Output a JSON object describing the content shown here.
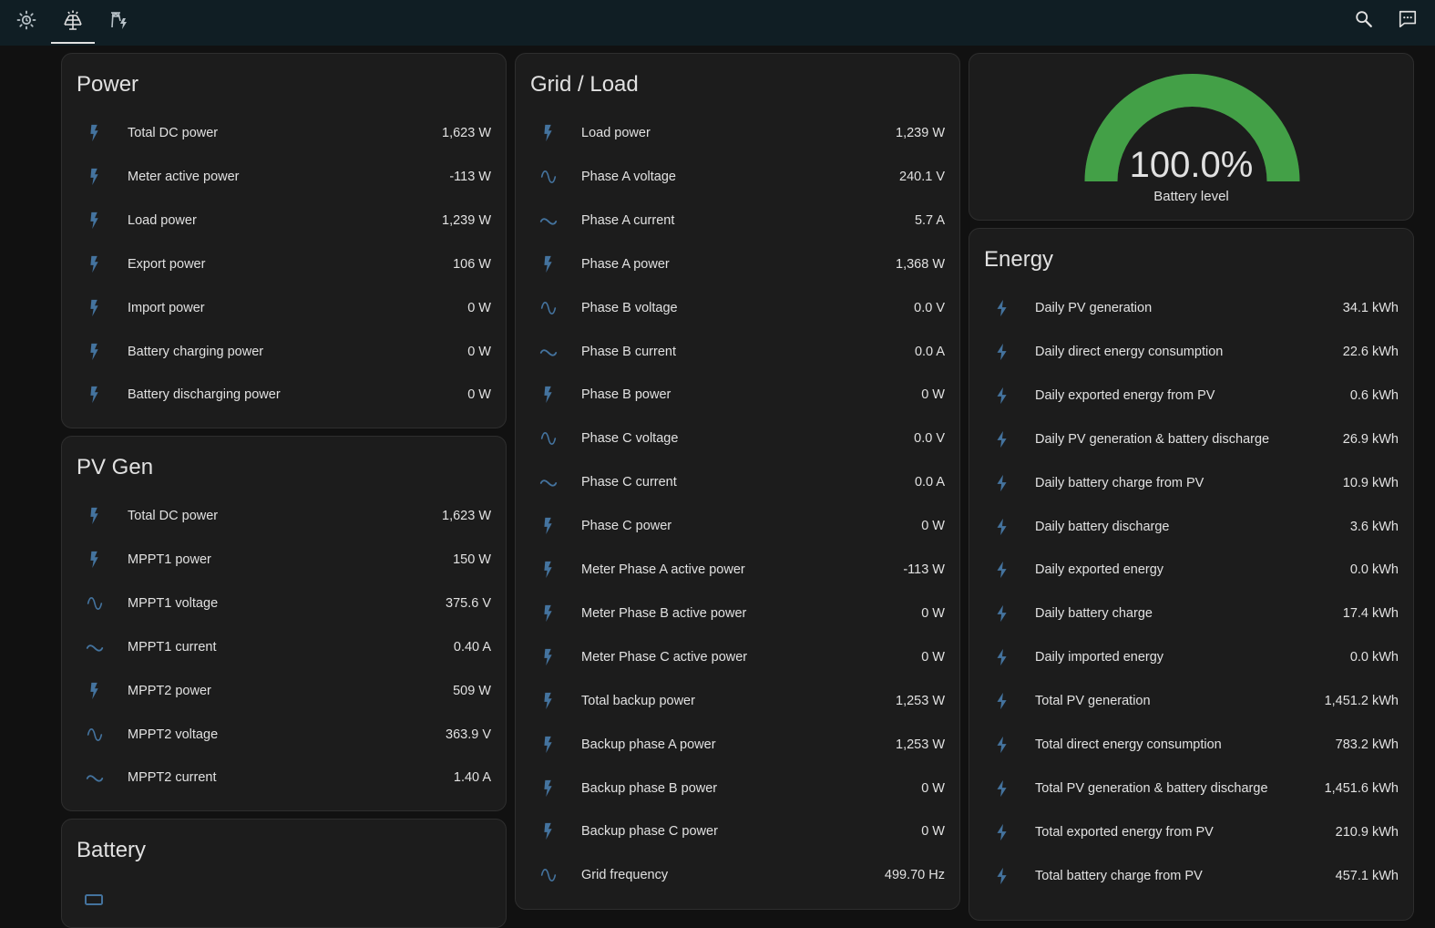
{
  "colors": {
    "header_bg": "#101e24",
    "card_bg": "#1c1c1c",
    "icon_blue": "#44739e",
    "gauge_green": "#43a047",
    "text": "#e1e1e1"
  },
  "header": {
    "tabs": [
      {
        "icon": "sun-clock-icon"
      },
      {
        "icon": "solar-panel-icon",
        "active": true
      },
      {
        "icon": "transmission-tower-icon"
      }
    ],
    "actions": [
      {
        "icon": "search-icon"
      },
      {
        "icon": "assist-chat-icon"
      }
    ]
  },
  "power": {
    "title": "Power",
    "rows": [
      {
        "icon": "flash-icon",
        "label": "Total DC power",
        "value": "1,623 W"
      },
      {
        "icon": "flash-icon",
        "label": "Meter active power",
        "value": "-113 W"
      },
      {
        "icon": "flash-icon",
        "label": "Load power",
        "value": "1,239 W"
      },
      {
        "icon": "flash-icon",
        "label": "Export power",
        "value": "106 W"
      },
      {
        "icon": "flash-icon",
        "label": "Import power",
        "value": "0 W"
      },
      {
        "icon": "flash-icon",
        "label": "Battery charging power",
        "value": "0 W"
      },
      {
        "icon": "flash-icon",
        "label": "Battery discharging power",
        "value": "0 W"
      }
    ]
  },
  "pvgen": {
    "title": "PV Gen",
    "rows": [
      {
        "icon": "flash-icon",
        "label": "Total DC power",
        "value": "1,623 W"
      },
      {
        "icon": "flash-icon",
        "label": "MPPT1 power",
        "value": "150 W"
      },
      {
        "icon": "sine-wave-icon",
        "label": "MPPT1 voltage",
        "value": "375.6 V"
      },
      {
        "icon": "current-ac-icon",
        "label": "MPPT1 current",
        "value": "0.40 A"
      },
      {
        "icon": "flash-icon",
        "label": "MPPT2 power",
        "value": "509 W"
      },
      {
        "icon": "sine-wave-icon",
        "label": "MPPT2 voltage",
        "value": "363.9 V"
      },
      {
        "icon": "current-ac-icon",
        "label": "MPPT2 current",
        "value": "1.40 A"
      }
    ]
  },
  "battery": {
    "title": "Battery"
  },
  "gridload": {
    "title": "Grid / Load",
    "rows": [
      {
        "icon": "flash-icon",
        "label": "Load power",
        "value": "1,239 W"
      },
      {
        "icon": "sine-wave-icon",
        "label": "Phase A voltage",
        "value": "240.1 V"
      },
      {
        "icon": "current-ac-icon",
        "label": "Phase A current",
        "value": "5.7 A"
      },
      {
        "icon": "flash-icon",
        "label": "Phase A power",
        "value": "1,368 W"
      },
      {
        "icon": "sine-wave-icon",
        "label": "Phase B voltage",
        "value": "0.0 V"
      },
      {
        "icon": "current-ac-icon",
        "label": "Phase B current",
        "value": "0.0 A"
      },
      {
        "icon": "flash-icon",
        "label": "Phase B power",
        "value": "0 W"
      },
      {
        "icon": "sine-wave-icon",
        "label": "Phase C voltage",
        "value": "0.0 V"
      },
      {
        "icon": "current-ac-icon",
        "label": "Phase C current",
        "value": "0.0 A"
      },
      {
        "icon": "flash-icon",
        "label": "Phase C power",
        "value": "0 W"
      },
      {
        "icon": "flash-icon",
        "label": "Meter Phase A active power",
        "value": "-113 W"
      },
      {
        "icon": "flash-icon",
        "label": "Meter Phase B active power",
        "value": "0 W"
      },
      {
        "icon": "flash-icon",
        "label": "Meter Phase C active power",
        "value": "0 W"
      },
      {
        "icon": "flash-icon",
        "label": "Total backup power",
        "value": "1,253 W"
      },
      {
        "icon": "flash-icon",
        "label": "Backup phase A power",
        "value": "1,253 W"
      },
      {
        "icon": "flash-icon",
        "label": "Backup phase B power",
        "value": "0 W"
      },
      {
        "icon": "flash-icon",
        "label": "Backup phase C power",
        "value": "0 W"
      },
      {
        "icon": "sine-wave-icon",
        "label": "Grid frequency",
        "value": "499.70 Hz"
      }
    ]
  },
  "gauge": {
    "value_text": "100.0%",
    "label": "Battery level",
    "fraction": 1.0
  },
  "energy": {
    "title": "Energy",
    "rows": [
      {
        "icon": "lightning-bolt-icon",
        "label": "Daily PV generation",
        "value": "34.1 kWh"
      },
      {
        "icon": "lightning-bolt-icon",
        "label": "Daily direct energy consumption",
        "value": "22.6 kWh"
      },
      {
        "icon": "lightning-bolt-icon",
        "label": "Daily exported energy from PV",
        "value": "0.6 kWh"
      },
      {
        "icon": "lightning-bolt-icon",
        "label": "Daily PV generation & battery discharge",
        "value": "26.9 kWh"
      },
      {
        "icon": "lightning-bolt-icon",
        "label": "Daily battery charge from PV",
        "value": "10.9 kWh"
      },
      {
        "icon": "lightning-bolt-icon",
        "label": "Daily battery discharge",
        "value": "3.6 kWh"
      },
      {
        "icon": "lightning-bolt-icon",
        "label": "Daily exported energy",
        "value": "0.0 kWh"
      },
      {
        "icon": "lightning-bolt-icon",
        "label": "Daily battery charge",
        "value": "17.4 kWh"
      },
      {
        "icon": "lightning-bolt-icon",
        "label": "Daily imported energy",
        "value": "0.0 kWh"
      },
      {
        "icon": "lightning-bolt-icon",
        "label": "Total PV generation",
        "value": "1,451.2 kWh"
      },
      {
        "icon": "lightning-bolt-icon",
        "label": "Total direct energy consumption",
        "value": "783.2 kWh"
      },
      {
        "icon": "lightning-bolt-icon",
        "label": "Total PV generation & battery discharge",
        "value": "1,451.6 kWh"
      },
      {
        "icon": "lightning-bolt-icon",
        "label": "Total exported energy from PV",
        "value": "210.9 kWh"
      },
      {
        "icon": "lightning-bolt-icon",
        "label": "Total battery charge from PV",
        "value": "457.1 kWh"
      }
    ]
  }
}
